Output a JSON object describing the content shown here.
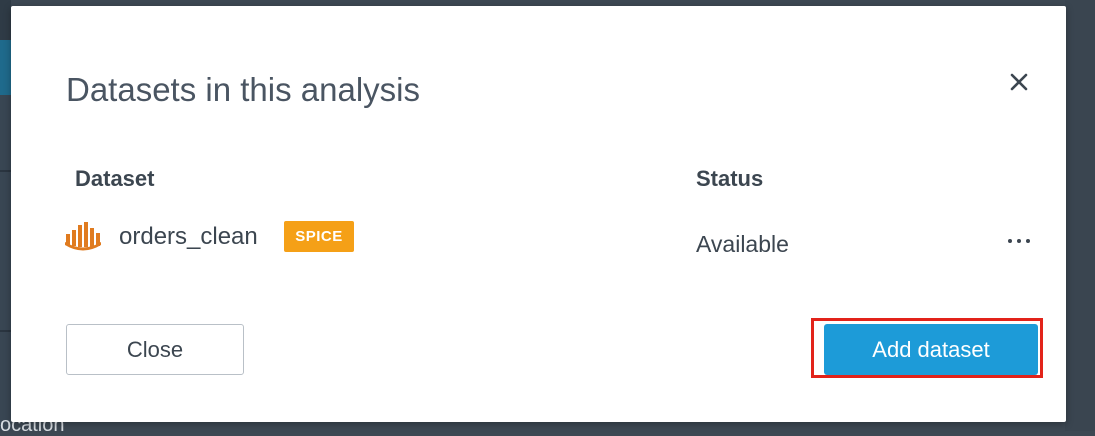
{
  "background": {
    "partial_text": "ocation"
  },
  "modal": {
    "title": "Datasets in this analysis",
    "close_icon": "close-icon"
  },
  "table": {
    "headers": [
      "Dataset",
      "Status"
    ],
    "rows": [
      {
        "icon": "dataset-bars-icon",
        "name": "orders_clean",
        "badge": "SPICE",
        "status": "Available",
        "more_icon": "more-options-icon"
      }
    ]
  },
  "footer": {
    "close_label": "Close",
    "add_label": "Add dataset"
  },
  "colors": {
    "primary_button": "#1d9bd8",
    "spice_badge": "#f5a017",
    "dataset_icon": "#e07b1f",
    "highlight": "#e2231a",
    "text": "#3c4650"
  }
}
